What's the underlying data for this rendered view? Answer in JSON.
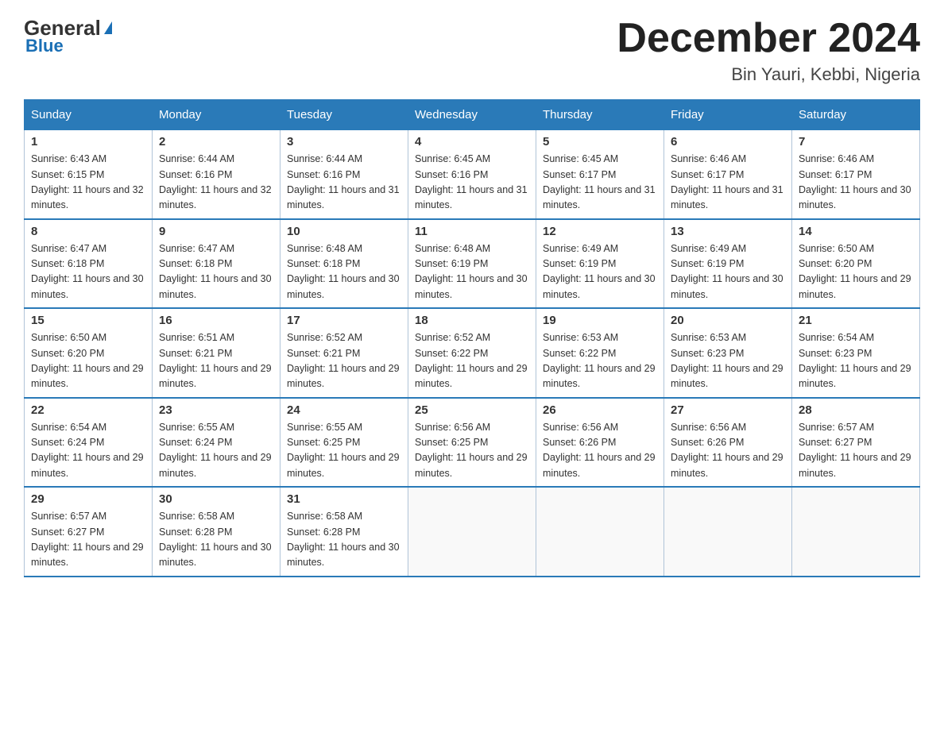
{
  "logo": {
    "general": "General",
    "blue": "Blue",
    "tagline": "Blue"
  },
  "title": "December 2024",
  "subtitle": "Bin Yauri, Kebbi, Nigeria",
  "days_header": [
    "Sunday",
    "Monday",
    "Tuesday",
    "Wednesday",
    "Thursday",
    "Friday",
    "Saturday"
  ],
  "weeks": [
    [
      {
        "day": "1",
        "sunrise": "6:43 AM",
        "sunset": "6:15 PM",
        "daylight": "11 hours and 32 minutes."
      },
      {
        "day": "2",
        "sunrise": "6:44 AM",
        "sunset": "6:16 PM",
        "daylight": "11 hours and 32 minutes."
      },
      {
        "day": "3",
        "sunrise": "6:44 AM",
        "sunset": "6:16 PM",
        "daylight": "11 hours and 31 minutes."
      },
      {
        "day": "4",
        "sunrise": "6:45 AM",
        "sunset": "6:16 PM",
        "daylight": "11 hours and 31 minutes."
      },
      {
        "day": "5",
        "sunrise": "6:45 AM",
        "sunset": "6:17 PM",
        "daylight": "11 hours and 31 minutes."
      },
      {
        "day": "6",
        "sunrise": "6:46 AM",
        "sunset": "6:17 PM",
        "daylight": "11 hours and 31 minutes."
      },
      {
        "day": "7",
        "sunrise": "6:46 AM",
        "sunset": "6:17 PM",
        "daylight": "11 hours and 30 minutes."
      }
    ],
    [
      {
        "day": "8",
        "sunrise": "6:47 AM",
        "sunset": "6:18 PM",
        "daylight": "11 hours and 30 minutes."
      },
      {
        "day": "9",
        "sunrise": "6:47 AM",
        "sunset": "6:18 PM",
        "daylight": "11 hours and 30 minutes."
      },
      {
        "day": "10",
        "sunrise": "6:48 AM",
        "sunset": "6:18 PM",
        "daylight": "11 hours and 30 minutes."
      },
      {
        "day": "11",
        "sunrise": "6:48 AM",
        "sunset": "6:19 PM",
        "daylight": "11 hours and 30 minutes."
      },
      {
        "day": "12",
        "sunrise": "6:49 AM",
        "sunset": "6:19 PM",
        "daylight": "11 hours and 30 minutes."
      },
      {
        "day": "13",
        "sunrise": "6:49 AM",
        "sunset": "6:19 PM",
        "daylight": "11 hours and 30 minutes."
      },
      {
        "day": "14",
        "sunrise": "6:50 AM",
        "sunset": "6:20 PM",
        "daylight": "11 hours and 29 minutes."
      }
    ],
    [
      {
        "day": "15",
        "sunrise": "6:50 AM",
        "sunset": "6:20 PM",
        "daylight": "11 hours and 29 minutes."
      },
      {
        "day": "16",
        "sunrise": "6:51 AM",
        "sunset": "6:21 PM",
        "daylight": "11 hours and 29 minutes."
      },
      {
        "day": "17",
        "sunrise": "6:52 AM",
        "sunset": "6:21 PM",
        "daylight": "11 hours and 29 minutes."
      },
      {
        "day": "18",
        "sunrise": "6:52 AM",
        "sunset": "6:22 PM",
        "daylight": "11 hours and 29 minutes."
      },
      {
        "day": "19",
        "sunrise": "6:53 AM",
        "sunset": "6:22 PM",
        "daylight": "11 hours and 29 minutes."
      },
      {
        "day": "20",
        "sunrise": "6:53 AM",
        "sunset": "6:23 PM",
        "daylight": "11 hours and 29 minutes."
      },
      {
        "day": "21",
        "sunrise": "6:54 AM",
        "sunset": "6:23 PM",
        "daylight": "11 hours and 29 minutes."
      }
    ],
    [
      {
        "day": "22",
        "sunrise": "6:54 AM",
        "sunset": "6:24 PM",
        "daylight": "11 hours and 29 minutes."
      },
      {
        "day": "23",
        "sunrise": "6:55 AM",
        "sunset": "6:24 PM",
        "daylight": "11 hours and 29 minutes."
      },
      {
        "day": "24",
        "sunrise": "6:55 AM",
        "sunset": "6:25 PM",
        "daylight": "11 hours and 29 minutes."
      },
      {
        "day": "25",
        "sunrise": "6:56 AM",
        "sunset": "6:25 PM",
        "daylight": "11 hours and 29 minutes."
      },
      {
        "day": "26",
        "sunrise": "6:56 AM",
        "sunset": "6:26 PM",
        "daylight": "11 hours and 29 minutes."
      },
      {
        "day": "27",
        "sunrise": "6:56 AM",
        "sunset": "6:26 PM",
        "daylight": "11 hours and 29 minutes."
      },
      {
        "day": "28",
        "sunrise": "6:57 AM",
        "sunset": "6:27 PM",
        "daylight": "11 hours and 29 minutes."
      }
    ],
    [
      {
        "day": "29",
        "sunrise": "6:57 AM",
        "sunset": "6:27 PM",
        "daylight": "11 hours and 29 minutes."
      },
      {
        "day": "30",
        "sunrise": "6:58 AM",
        "sunset": "6:28 PM",
        "daylight": "11 hours and 30 minutes."
      },
      {
        "day": "31",
        "sunrise": "6:58 AM",
        "sunset": "6:28 PM",
        "daylight": "11 hours and 30 minutes."
      },
      null,
      null,
      null,
      null
    ]
  ]
}
